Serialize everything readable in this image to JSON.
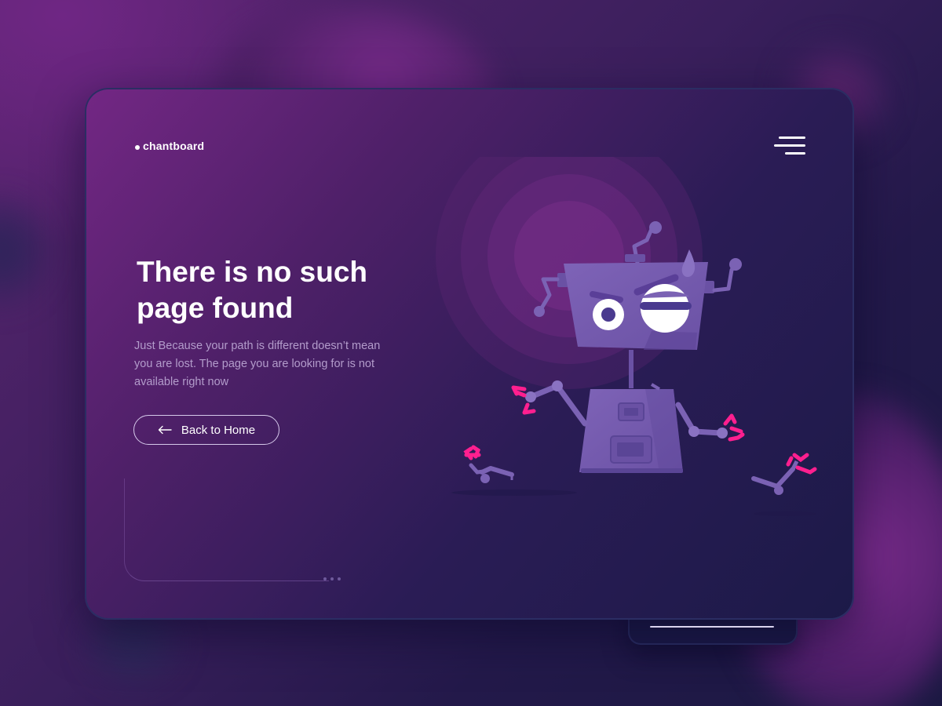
{
  "brand": {
    "name": "chantboard"
  },
  "header": {
    "menu_icon": "hamburger-menu-icon"
  },
  "hero": {
    "title": "There is no such page found",
    "description": "Just Because your path is different doesn’t mean you are lost. The page you are looking for is not available right now"
  },
  "actions": {
    "back_home_label": "Back to Home",
    "back_icon": "arrow-left-icon"
  },
  "illustration": {
    "subject": "robot-icon"
  },
  "colors": {
    "accent": "#ff1f8f",
    "robot_body": "#7b62b4",
    "background_dark": "#1c1a48",
    "background_purple": "#732784"
  }
}
